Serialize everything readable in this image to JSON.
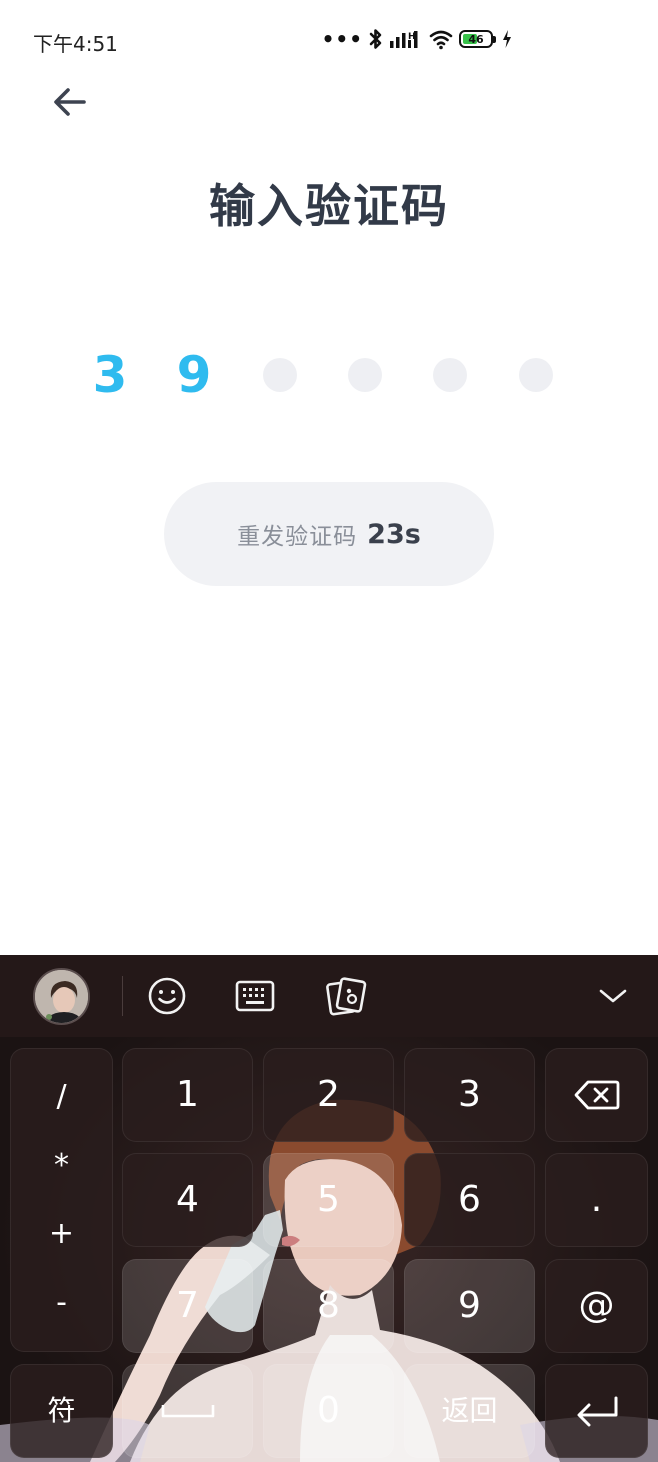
{
  "status_bar": {
    "time": "下午4:51",
    "icons": [
      "more-dots-icon",
      "bluetooth-icon",
      "signal-hd-icon",
      "wifi-icon",
      "battery-icon",
      "charging-icon"
    ],
    "battery_level": "46"
  },
  "header": {
    "back_icon": "back-arrow-icon",
    "title": "输入验证码"
  },
  "code": {
    "slots": [
      "3",
      "9",
      "",
      "",
      "",
      ""
    ],
    "active_color": "#2fbbef",
    "empty_color": "#eeeff3"
  },
  "resend": {
    "label": "重发验证码",
    "countdown": "23s"
  },
  "keyboard": {
    "toolbar_icons": [
      "avatar",
      "emoji-icon",
      "keyboard-icon",
      "photo-cards-icon",
      "collapse-chevron-icon"
    ],
    "symbols": [
      "/",
      "*",
      "+",
      "-"
    ],
    "keys": {
      "k1": "1",
      "k2": "2",
      "k3": "3",
      "k4": "4",
      "k5": "5",
      "k6": "6",
      "k7": "7",
      "k8": "8",
      "k9": "9",
      "k0": "0",
      "dot": ".",
      "at": "@",
      "fu": "符",
      "back": "返回"
    },
    "special_icons": [
      "backspace-icon",
      "space-bar-icon",
      "enter-icon"
    ]
  }
}
